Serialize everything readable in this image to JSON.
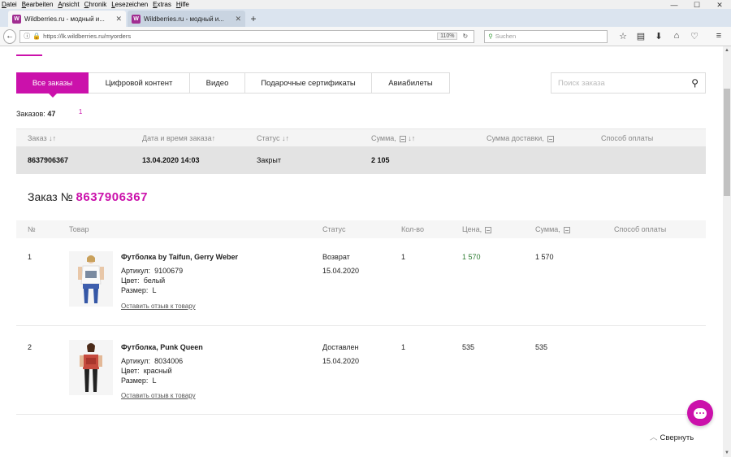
{
  "browser": {
    "menu": [
      "Datei",
      "Bearbeiten",
      "Ansicht",
      "Chronik",
      "Lesezeichen",
      "Extras",
      "Hilfe"
    ],
    "tabs": [
      {
        "title": "Wildberries.ru - модный и..."
      },
      {
        "title": "Wildberries.ru - модный и..."
      }
    ],
    "url": "https://lk.wildberries.ru/myorders",
    "zoom": "110%",
    "search_placeholder": "Suchen"
  },
  "page": {
    "tabs": [
      "Все заказы",
      "Цифровой контент",
      "Видео",
      "Подарочные сертификаты",
      "Авиабилеты"
    ],
    "search_placeholder": "Поиск заказа",
    "orders_count_label": "Заказов:",
    "orders_count": "47",
    "page_number": "1",
    "orders_table": {
      "headers": [
        "Заказ",
        "Дата и время заказа",
        "Статус",
        "Сумма,",
        "Сумма доставки,",
        "Способ оплаты"
      ],
      "sort_icon": "↓↑",
      "row": {
        "number": "8637906367",
        "date": "13.04.2020 14:03",
        "status": "Закрыт",
        "sum": "2 105"
      }
    },
    "detail": {
      "title_prefix": "Заказ №",
      "order_number": "8637906367",
      "headers": [
        "№",
        "Товар",
        "Статус",
        "Кол-во",
        "Цена,",
        "Сумма,",
        "Способ оплаты"
      ],
      "items": [
        {
          "n": "1",
          "name": "Футболка by Taifun, Gerry Weber",
          "article_label": "Артикул:",
          "article": "9100679",
          "color_label": "Цвет:",
          "color": "белый",
          "size_label": "Размер:",
          "size": "L",
          "review": "Оставить отзыв к товару",
          "status": "Возврат",
          "status_date": "15.04.2020",
          "qty": "1",
          "price": "1 570",
          "sum": "1 570"
        },
        {
          "n": "2",
          "name": "Футболка, Punk Queen",
          "article_label": "Артикул:",
          "article": "8034006",
          "color_label": "Цвет:",
          "color": "красный",
          "size_label": "Размер:",
          "size": "L",
          "review": "Оставить отзыв к товару",
          "status": "Доставлен",
          "status_date": "15.04.2020",
          "qty": "1",
          "price": "535",
          "sum": "535"
        }
      ],
      "collapse_label": "Свернуть"
    }
  },
  "colors": {
    "accent": "#cb11ab",
    "price_green": "#2e7d32"
  }
}
